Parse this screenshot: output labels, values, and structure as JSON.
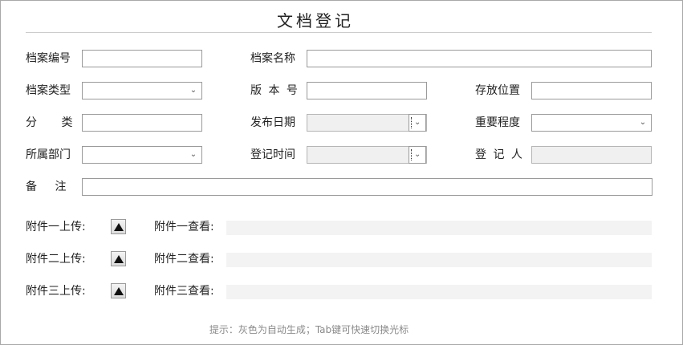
{
  "form": {
    "title": "文档登记",
    "fields": {
      "archive_no": {
        "label": "档案编号",
        "value": ""
      },
      "archive_name": {
        "label": "档案名称",
        "value": ""
      },
      "archive_type": {
        "label": "档案类型",
        "value": ""
      },
      "version_no": {
        "label": "版 本 号",
        "value": ""
      },
      "storage_location": {
        "label": "存放位置",
        "value": ""
      },
      "category": {
        "label": "分 类",
        "value": ""
      },
      "publish_date": {
        "label": "发布日期",
        "value": ""
      },
      "importance": {
        "label": "重要程度",
        "value": ""
      },
      "department": {
        "label": "所属部门",
        "value": ""
      },
      "register_time": {
        "label": "登记时间",
        "value": ""
      },
      "registrant": {
        "label": "登 记 人",
        "value": ""
      },
      "remarks": {
        "label": "备 注",
        "value": ""
      }
    },
    "attachments": [
      {
        "upload_label": "附件一上传:",
        "view_label": "附件一查看:",
        "value": ""
      },
      {
        "upload_label": "附件二上传:",
        "view_label": "附件二查看:",
        "value": ""
      },
      {
        "upload_label": "附件三上传:",
        "view_label": "附件三查看:",
        "value": ""
      }
    ],
    "hint": "提示：灰色为自动生成；Tab键可快速切换光标"
  },
  "icons": {
    "dropdown": "chevron-down-icon",
    "upload": "upload-triangle-icon"
  },
  "colors": {
    "readonly_bg": "#f0f0f0",
    "border": "#9a9a9a",
    "hint": "#8a8a8a"
  }
}
